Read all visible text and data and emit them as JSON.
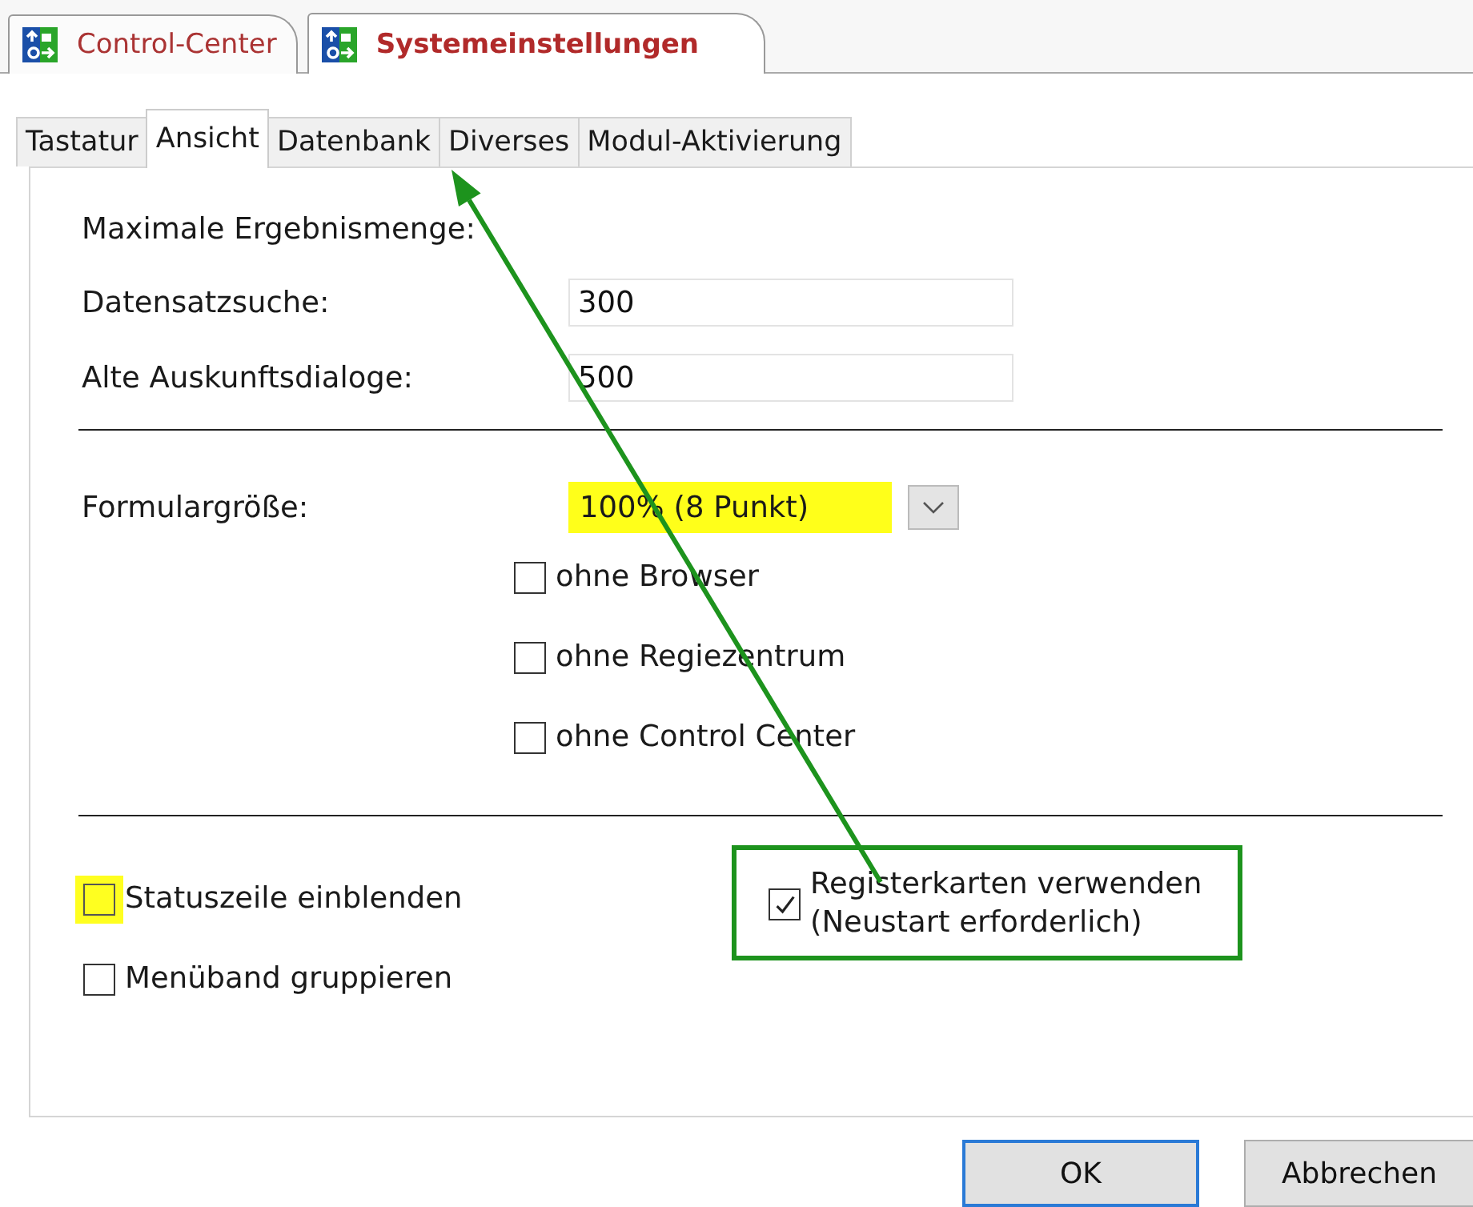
{
  "document_tabs": [
    {
      "label": "Control-Center",
      "selected": false
    },
    {
      "label": "Systemeinstellungen",
      "selected": true
    }
  ],
  "tabs": [
    {
      "label": "Tastatur",
      "selected": false
    },
    {
      "label": "Ansicht",
      "selected": true
    },
    {
      "label": "Datenbank",
      "selected": false
    },
    {
      "label": "Diverses",
      "selected": false
    },
    {
      "label": "Modul-Aktivierung",
      "selected": false
    }
  ],
  "section_title": "Maximale Ergebnismenge:",
  "fields": [
    {
      "label": "Datensatzsuche:",
      "value": "300"
    },
    {
      "label": "Alte Auskunftsdialoge:",
      "value": "500"
    }
  ],
  "form_size": {
    "label": "Formulargröße:",
    "value": "100% (8 Punkt)",
    "highlighted": true
  },
  "form_options": [
    {
      "label": "ohne Browser",
      "checked": false
    },
    {
      "label": "ohne Regiezentrum",
      "checked": false
    },
    {
      "label": "ohne Control Center",
      "checked": false
    }
  ],
  "bottom_options": [
    {
      "label": "Statuszeile einblenden",
      "checked": false,
      "highlighted": true
    },
    {
      "label": "Menüband gruppieren",
      "checked": false,
      "highlighted": false
    }
  ],
  "restart_option": {
    "label": "Registerkarten verwenden",
    "note": "(Neustart erforderlich)",
    "checked": true,
    "framed": true
  },
  "annotations": {
    "arrow": true
  },
  "buttons": [
    {
      "label": "OK",
      "default": true
    },
    {
      "label": "Abbrechen",
      "default": false
    }
  ]
}
